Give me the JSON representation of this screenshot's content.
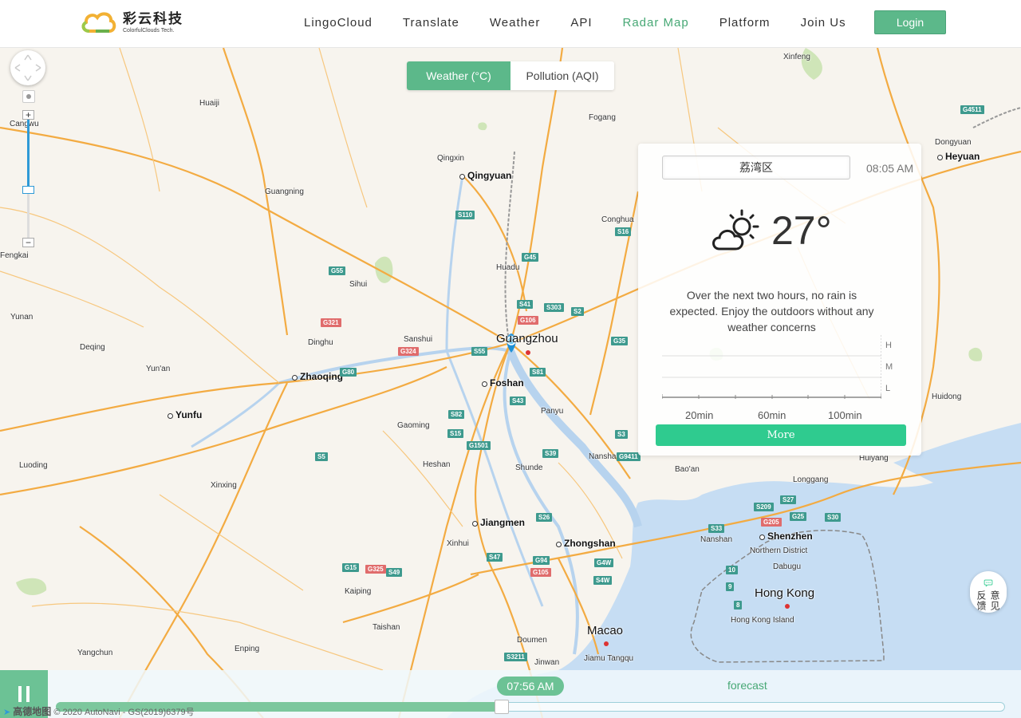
{
  "header": {
    "logo_cn": "彩云科技",
    "logo_en": "ColorfulClouds Tech.",
    "nav": [
      {
        "label": "LingoCloud",
        "active": false
      },
      {
        "label": "Translate",
        "active": false
      },
      {
        "label": "Weather",
        "active": false
      },
      {
        "label": "API",
        "active": false
      },
      {
        "label": "Radar Map",
        "active": true
      },
      {
        "label": "Platform",
        "active": false
      },
      {
        "label": "Join Us",
        "active": false
      }
    ],
    "login_label": "Login"
  },
  "toggle": {
    "weather_label": "Weather (°C)",
    "pollution_label": "Pollution (AQI)",
    "selected": "weather"
  },
  "panel": {
    "location": "荔湾区",
    "time": "08:05 AM",
    "icon": "partly-cloudy-day-icon",
    "temperature": "27°",
    "description": "Over the next two hours, no rain is expected. Enjoy the outdoors without any weather concerns",
    "levels": [
      "H",
      "M",
      "L"
    ],
    "ticks": [
      "20min",
      "60min",
      "100min"
    ],
    "more_label": "More"
  },
  "feedback": {
    "label": "意见反馈",
    "icon": "chat-bubble-icon"
  },
  "timeline": {
    "current_time": "07:56 AM",
    "forecast_label": "forecast",
    "progress": 0.47,
    "paused": false
  },
  "map": {
    "attribution_brand": "高德地图",
    "attribution_text": "© 2020 AutoNavi - GS(2019)6379号",
    "places": [
      {
        "name": "Guangzhou",
        "cls": "huge"
      },
      {
        "name": "Foshan",
        "cls": "big"
      },
      {
        "name": "Qingyuan",
        "cls": "big"
      },
      {
        "name": "Zhaoqing",
        "cls": "big"
      },
      {
        "name": "Yunfu",
        "cls": "big"
      },
      {
        "name": "Jiangmen",
        "cls": "big"
      },
      {
        "name": "Zhongshan",
        "cls": "big"
      },
      {
        "name": "Shenzhen",
        "cls": "big"
      },
      {
        "name": "Hong Kong",
        "cls": "huge"
      },
      {
        "name": "Macao",
        "cls": "huge"
      },
      {
        "name": "Heyuan",
        "cls": "big"
      },
      {
        "name": "Huaiji",
        "cls": ""
      },
      {
        "name": "Cangwu",
        "cls": ""
      },
      {
        "name": "Fengkai",
        "cls": ""
      },
      {
        "name": "Yunan",
        "cls": ""
      },
      {
        "name": "Deqing",
        "cls": ""
      },
      {
        "name": "Yun'an",
        "cls": ""
      },
      {
        "name": "Luoding",
        "cls": ""
      },
      {
        "name": "Xinxing",
        "cls": ""
      },
      {
        "name": "Guangning",
        "cls": ""
      },
      {
        "name": "Sihui",
        "cls": ""
      },
      {
        "name": "Dinghu",
        "cls": ""
      },
      {
        "name": "Sanshui",
        "cls": ""
      },
      {
        "name": "Gaoming",
        "cls": ""
      },
      {
        "name": "Heshan",
        "cls": ""
      },
      {
        "name": "Shunde",
        "cls": ""
      },
      {
        "name": "Panyu",
        "cls": ""
      },
      {
        "name": "Nansha",
        "cls": ""
      },
      {
        "name": "Huadu",
        "cls": ""
      },
      {
        "name": "Qingxin",
        "cls": ""
      },
      {
        "name": "Conghua",
        "cls": ""
      },
      {
        "name": "Fogang",
        "cls": ""
      },
      {
        "name": "Xinfeng",
        "cls": ""
      },
      {
        "name": "Dongyuan",
        "cls": ""
      },
      {
        "name": "Huidong",
        "cls": ""
      },
      {
        "name": "Huiyang",
        "cls": ""
      },
      {
        "name": "Longgang",
        "cls": ""
      },
      {
        "name": "Bao'an",
        "cls": ""
      },
      {
        "name": "Nanshan",
        "cls": ""
      },
      {
        "name": "Northern District",
        "cls": ""
      },
      {
        "name": "Dabugu",
        "cls": ""
      },
      {
        "name": "Hong Kong Island",
        "cls": ""
      },
      {
        "name": "Xinhui",
        "cls": ""
      },
      {
        "name": "Kaiping",
        "cls": ""
      },
      {
        "name": "Taishan",
        "cls": ""
      },
      {
        "name": "Enping",
        "cls": ""
      },
      {
        "name": "Yangchun",
        "cls": ""
      },
      {
        "name": "Doumen",
        "cls": ""
      },
      {
        "name": "Jinwan",
        "cls": ""
      },
      {
        "name": "Jiamu Tangqu",
        "cls": ""
      }
    ],
    "shields": [
      {
        "code": "G55",
        "red": false
      },
      {
        "code": "G321",
        "red": true
      },
      {
        "code": "G80",
        "red": false
      },
      {
        "code": "G324",
        "red": true
      },
      {
        "code": "S55",
        "red": false
      },
      {
        "code": "S41",
        "red": false
      },
      {
        "code": "G106",
        "red": true
      },
      {
        "code": "S303",
        "red": false
      },
      {
        "code": "S2",
        "red": false
      },
      {
        "code": "G45",
        "red": false
      },
      {
        "code": "S110",
        "red": false
      },
      {
        "code": "S16",
        "red": false
      },
      {
        "code": "S81",
        "red": false
      },
      {
        "code": "S43",
        "red": false
      },
      {
        "code": "S82",
        "red": false
      },
      {
        "code": "S15",
        "red": false
      },
      {
        "code": "G1501",
        "red": false
      },
      {
        "code": "S5",
        "red": false
      },
      {
        "code": "S39",
        "red": false
      },
      {
        "code": "S3",
        "red": false
      },
      {
        "code": "G9411",
        "red": false
      },
      {
        "code": "G35",
        "red": false
      },
      {
        "code": "S26",
        "red": false
      },
      {
        "code": "S47",
        "red": false
      },
      {
        "code": "G94",
        "red": false
      },
      {
        "code": "G105",
        "red": true
      },
      {
        "code": "G4W",
        "red": false
      },
      {
        "code": "S4W",
        "red": false
      },
      {
        "code": "G15",
        "red": false
      },
      {
        "code": "G325",
        "red": true
      },
      {
        "code": "S49",
        "red": false
      },
      {
        "code": "S3211",
        "red": false
      },
      {
        "code": "S33",
        "red": false
      },
      {
        "code": "S209",
        "red": false
      },
      {
        "code": "G205",
        "red": true
      },
      {
        "code": "S27",
        "red": false
      },
      {
        "code": "G25",
        "red": false
      },
      {
        "code": "S30",
        "red": false
      },
      {
        "code": "10",
        "red": false
      },
      {
        "code": "9",
        "red": false
      },
      {
        "code": "8",
        "red": false
      },
      {
        "code": "G4511",
        "red": false
      }
    ]
  }
}
